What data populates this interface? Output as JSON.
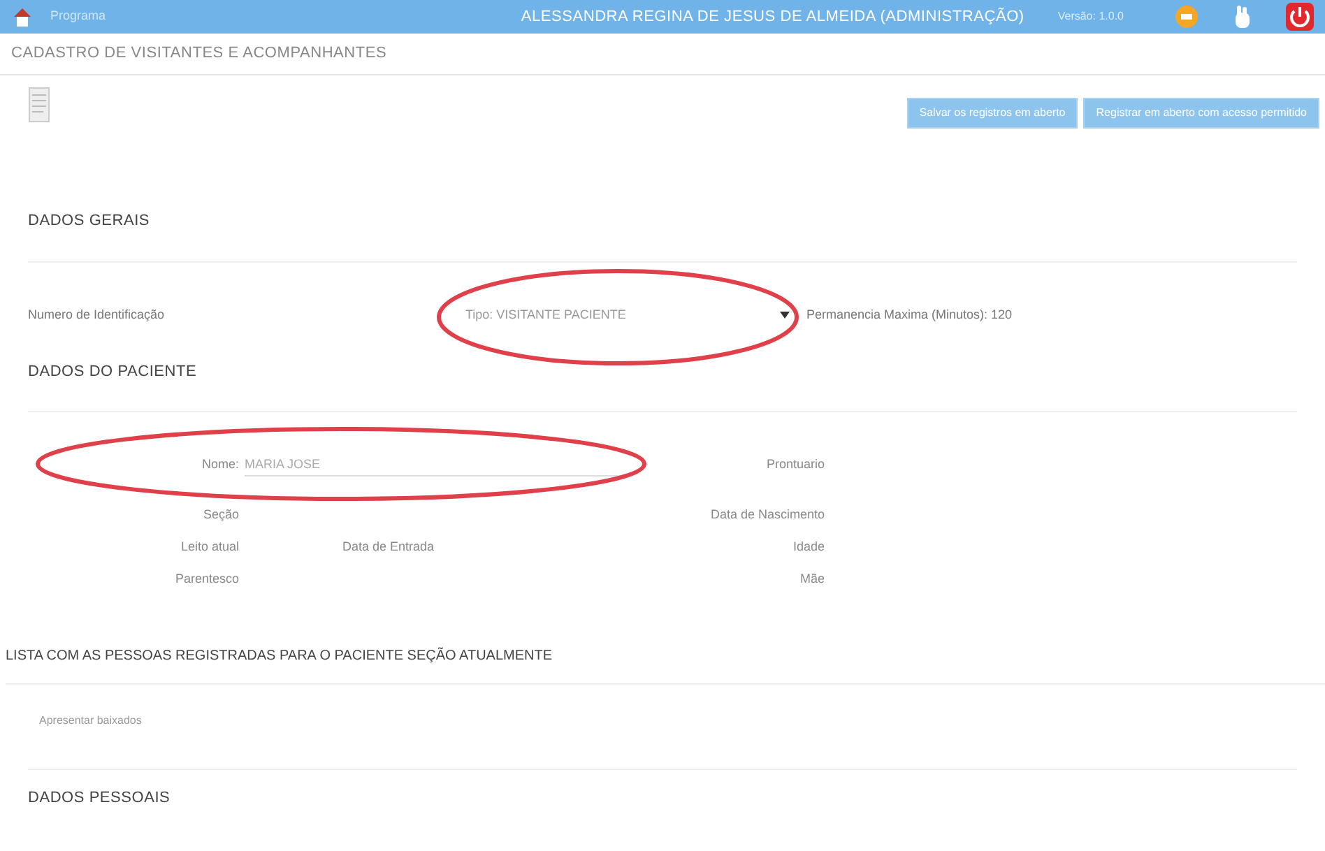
{
  "header": {
    "program": "Programa",
    "user": "ALESSANDRA REGINA DE JESUS DE ALMEIDA (ADMINISTRAÇÃO)",
    "version": "Versão: 1.0.0"
  },
  "page_title": "CADASTRO DE VISITANTES E ACOMPANHANTES",
  "buttons": [
    "Salvar os registros em aberto",
    "Registrar em aberto com acesso permitido"
  ],
  "general": {
    "title": "DADOS GERAIS",
    "id_label": "Numero de Identificação",
    "type_label": "Tipo:",
    "type_value": "VISITANTE PACIENTE",
    "stay_label": "Permanencia Maxima (Minutos):",
    "stay_value": "120"
  },
  "patient": {
    "title": "DADOS DO PACIENTE",
    "name_label": "Nome:",
    "name_value": "MARIA JOSE",
    "left_labels": [
      "Seção",
      "Leito atual",
      "Parentesco"
    ],
    "entry_label": "Data de Entrada",
    "right_labels": [
      "Prontuario",
      "Data de Nascimento",
      "Idade",
      "Mãe"
    ]
  },
  "list": {
    "title": "LISTA COM AS PESSOAS REGISTRADAS PARA O PACIENTE SEÇÃO ATUALMENTE",
    "option": "Apresentar baixados"
  },
  "personal": {
    "title": "DADOS PESSOAIS"
  }
}
